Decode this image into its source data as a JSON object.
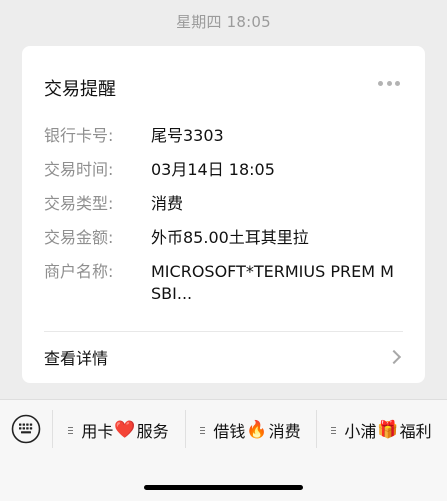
{
  "timestamp": "星期四 18:05",
  "card": {
    "title": "交易提醒",
    "rows": [
      {
        "label": "银行卡号:",
        "value": "尾号3303"
      },
      {
        "label": "交易时间:",
        "value": "03月14日 18:05"
      },
      {
        "label": "交易类型:",
        "value": "消费"
      },
      {
        "label": "交易金额:",
        "value": "外币85.00土耳其里拉"
      },
      {
        "label": "商户名称:",
        "value": "MICROSOFT*TERMIUS PREM MSBI..."
      }
    ],
    "details_label": "查看详情"
  },
  "menu": {
    "items": [
      {
        "text_before": "用卡",
        "emoji": "❤️",
        "text_after": "服务"
      },
      {
        "text_before": "借钱",
        "emoji": "🔥",
        "text_after": "消费"
      },
      {
        "text_before": "小浦",
        "emoji": "🎁",
        "text_after": "福利"
      }
    ]
  },
  "icons": {
    "more": "more-dots-icon",
    "details": "chevron-right-icon",
    "keyboard": "keyboard-icon",
    "menu_item": "list-icon"
  },
  "colors": {
    "background": "#ededed",
    "card": "#ffffff",
    "label": "#8f8f8f",
    "text": "#111111"
  }
}
